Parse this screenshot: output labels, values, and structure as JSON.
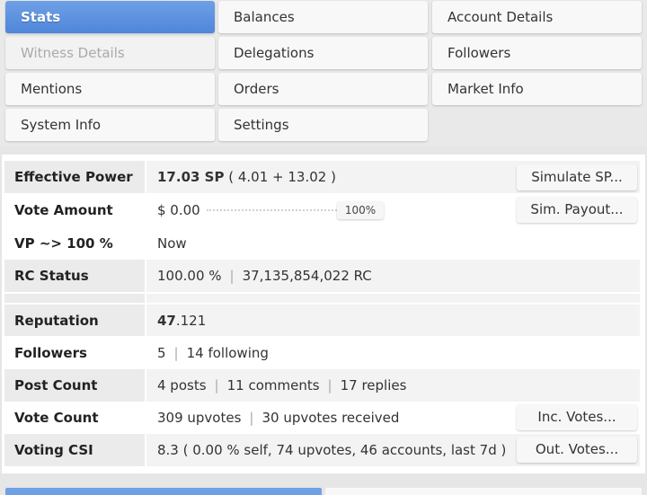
{
  "tabs": [
    {
      "label": "Stats",
      "state": "active"
    },
    {
      "label": "Balances",
      "state": "normal"
    },
    {
      "label": "Account Details",
      "state": "normal"
    },
    {
      "label": "Witness Details",
      "state": "disabled"
    },
    {
      "label": "Delegations",
      "state": "normal"
    },
    {
      "label": "Followers",
      "state": "normal"
    },
    {
      "label": "Mentions",
      "state": "normal"
    },
    {
      "label": "Orders",
      "state": "normal"
    },
    {
      "label": "Market Info",
      "state": "normal"
    },
    {
      "label": "System Info",
      "state": "normal"
    },
    {
      "label": "Settings",
      "state": "normal"
    }
  ],
  "stats": {
    "effective_power": {
      "label": "Effective Power",
      "value_bold": "17.03 SP",
      "value_rest": "( 4.01 + 13.02 )",
      "button": "Simulate SP..."
    },
    "vote_amount": {
      "label": "Vote Amount",
      "value": "$ 0.00",
      "slider_label": "100%",
      "slider_level": 1.0,
      "button": "Sim. Payout..."
    },
    "vp": {
      "label": "VP ~> 100 %",
      "value": "Now"
    },
    "rc_status": {
      "label": "RC Status",
      "percent": "100.00 %",
      "amount": "37,135,854,022 RC"
    },
    "reputation": {
      "label": "Reputation",
      "value_bold": "47",
      "value_rest": ".121"
    },
    "followers": {
      "label": "Followers",
      "count": "5",
      "following": "14 following"
    },
    "post_count": {
      "label": "Post Count",
      "posts": "4 posts",
      "comments": "11 comments",
      "replies": "17 replies"
    },
    "vote_count": {
      "label": "Vote Count",
      "upvotes": "309 upvotes",
      "received": "30 upvotes received",
      "button": "Inc. Votes..."
    },
    "voting_csi": {
      "label": "Voting CSI",
      "value": "8.3 ( 0.00 % self, 74 upvotes, 46 accounts, last 7d )",
      "button": "Out. Votes..."
    }
  },
  "separator": "|",
  "colors": {
    "accent": "#5b8fdf",
    "row_shade": "#f3f3f3",
    "background": "#e6e6e6"
  }
}
